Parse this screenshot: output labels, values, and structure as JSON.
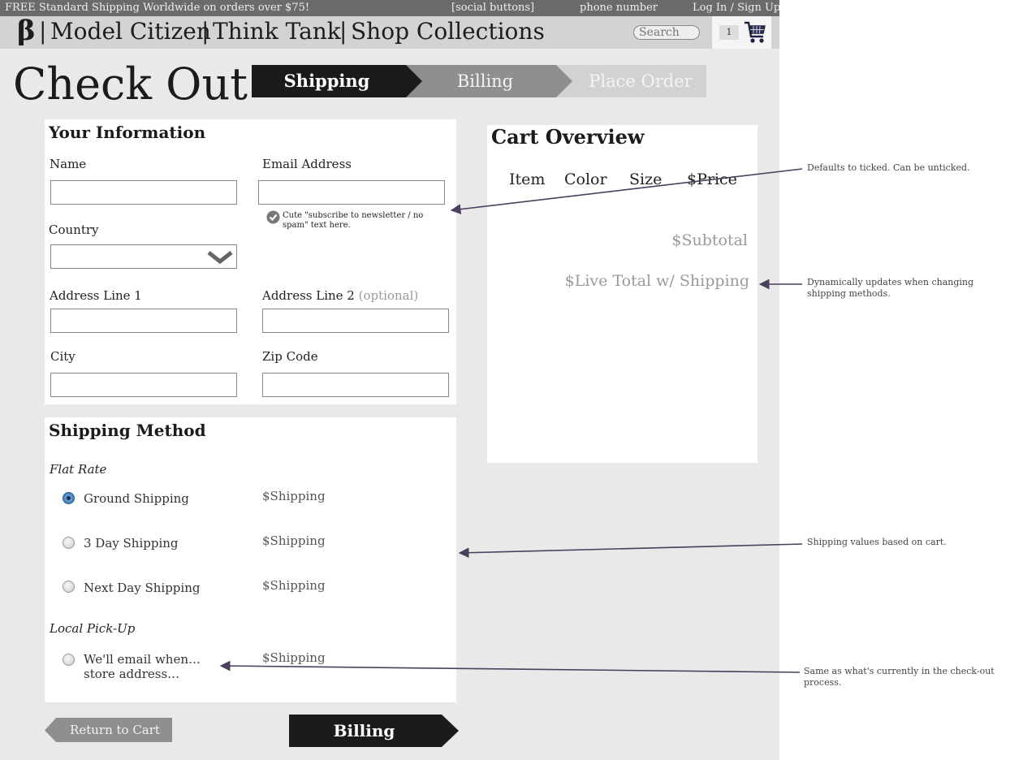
{
  "topbar": {
    "promo": "FREE Standard Shipping Worldwide on orders over $75!",
    "social": "[social buttons]",
    "phone": "phone number",
    "login": "Log In / Sign Up"
  },
  "nav": {
    "logo": "β",
    "links": [
      "Model Citizen",
      "Think Tank",
      "Shop Collections"
    ],
    "separator": "|",
    "search_placeholder": "Search",
    "cart_count": "1"
  },
  "page_title": "Check Out",
  "steps": [
    {
      "label": "Shipping",
      "state": "active"
    },
    {
      "label": "Billing",
      "state": "next"
    },
    {
      "label": "Place Order",
      "state": "later"
    }
  ],
  "your_info": {
    "heading": "Your Information",
    "name_label": "Name",
    "email_label": "Email Address",
    "newsletter_text": "Cute \"subscribe to newsletter / no spam\" text here.",
    "country_label": "Country",
    "address1_label": "Address Line 1",
    "address2_label": "Address Line 2",
    "address2_optional": "(optional)",
    "city_label": "City",
    "zip_label": "Zip Code"
  },
  "shipping": {
    "heading": "Shipping Method",
    "flat_rate_label": "Flat Rate",
    "options": [
      {
        "label": "Ground Shipping",
        "price": "$Shipping",
        "selected": true
      },
      {
        "label": "3 Day Shipping",
        "price": "$Shipping",
        "selected": false
      },
      {
        "label": "Next Day Shipping",
        "price": "$Shipping",
        "selected": false
      }
    ],
    "pickup_label": "Local Pick-Up",
    "pickup": {
      "line1": "We'll email when…",
      "line2": "store address…",
      "price": "$Shipping",
      "selected": false
    }
  },
  "cart": {
    "heading": "Cart Overview",
    "columns": [
      "Item",
      "Color",
      "Size",
      "$Price"
    ],
    "subtotal": "$Subtotal",
    "live_total": "$Live Total w/ Shipping"
  },
  "buttons": {
    "return": "Return to Cart",
    "next": "Billing"
  },
  "annotations": [
    "Defaults to ticked. Can be unticked.",
    "Dynamically updates when changing shipping methods.",
    "Shipping values based on cart.",
    "Same as what's currently in the check-out process."
  ],
  "colors": {
    "step_active": "#1b1b1b",
    "step_next": "#8f8f8f",
    "step_later": "#d2d2d2",
    "radio_selected": "#3b76b8",
    "arrow": "#4a3f5c"
  }
}
